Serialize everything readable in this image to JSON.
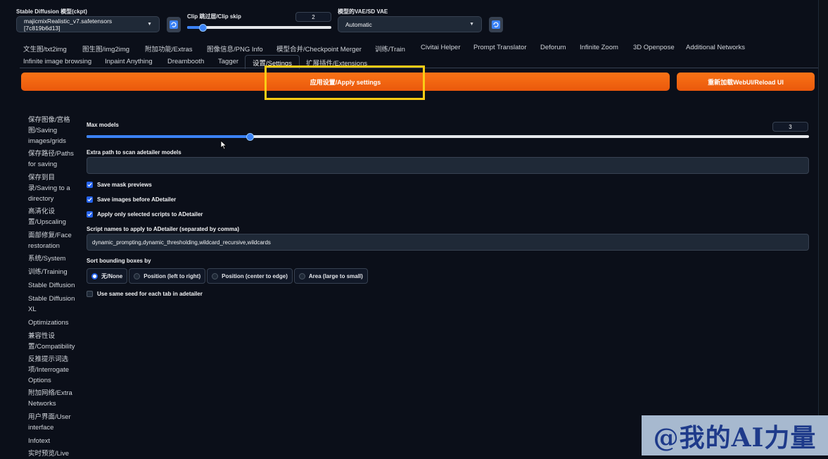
{
  "header": {
    "ckpt_label": "Stable Diffusion 模型(ckpt)",
    "ckpt_value": "majicmixRealistic_v7.safetensors [7c819b6d13]",
    "clip_label": "Clip 跳过层/Clip skip",
    "clip_value": "2",
    "clip_level_fraction": 0.08,
    "vae_label": "模型的VAE/SD VAE",
    "vae_value": "Automatic",
    "refresh_icon": "refresh-icon"
  },
  "tabs_row1": [
    "文生图/txt2img",
    "图生图/img2img",
    "附加功能/Extras",
    "图像信息/PNG Info",
    "模型合并/Checkpoint Merger",
    "训练/Train",
    "Civitai Helper",
    "Prompt Translator",
    "Deforum",
    "Infinite Zoom",
    "3D Openpose",
    "Additional Networks"
  ],
  "tabs_row2": [
    "Infinite image browsing",
    "Inpaint Anything",
    "Dreambooth",
    "Tagger",
    "设置/Settings",
    "扩展插件/Extensions"
  ],
  "buttons": {
    "apply": "应用设置/Apply settings",
    "reload": "重新加载WebUI/Reload UI"
  },
  "sidebar": [
    "保存图像/宫格图/Saving images/grids",
    "保存路径/Paths for saving",
    "保存到目录/Saving to a directory",
    "高清化设置/Upscaling",
    "面部修复/Face restoration",
    "系统/System",
    "训练/Training",
    "Stable Diffusion",
    "Stable Diffusion XL",
    "Optimizations",
    "兼容性设置/Compatibility",
    "反推提示词选项/Interrogate Options",
    "附加网络/Extra Networks",
    "用户界面/User interface",
    "Infotext",
    "实时预览/Live"
  ],
  "settings": {
    "max_models_label": "Max models",
    "max_models_value": "3",
    "max_models_fraction": 0.22,
    "extra_path_label": "Extra path to scan adetailer models",
    "extra_path_value": "",
    "save_mask_label": "Save mask previews",
    "save_before_label": "Save images before ADetailer",
    "apply_only_label": "Apply only selected scripts to ADetailer",
    "script_names_label": "Script names to apply to ADetailer (separated by comma)",
    "script_names_value": "dynamic_prompting,dynamic_thresholding,wildcard_recursive,wildcards",
    "sort_label": "Sort bounding boxes by",
    "sort_options": [
      "无/None",
      "Position (left to right)",
      "Position (center to edge)",
      "Area (large to small)"
    ],
    "sort_selected": "无/None",
    "same_seed_label": "Use same seed for each tab in adetailer"
  },
  "watermark": "@我的AI力量",
  "colors": {
    "accent": "#f97316",
    "highlight": "#facc15",
    "primary": "#2563eb"
  }
}
